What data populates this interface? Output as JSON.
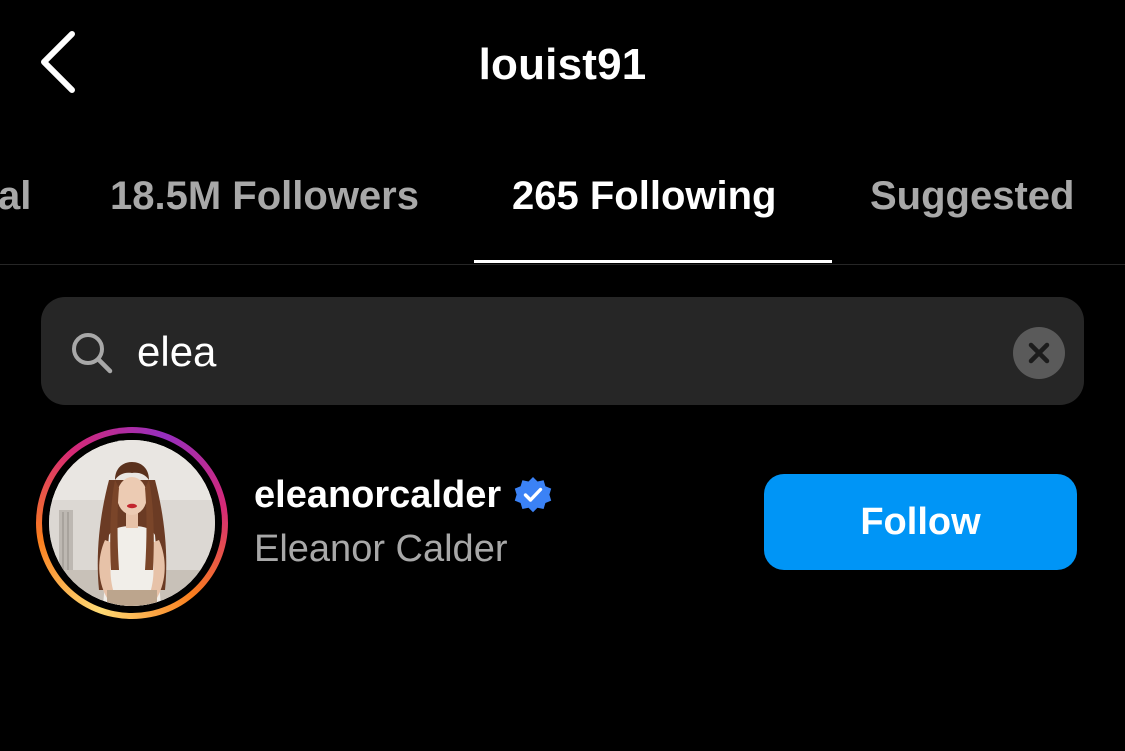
{
  "header": {
    "title": "louist91",
    "back_icon": "chevron-left-icon"
  },
  "tabs": [
    {
      "label": "al",
      "active": false
    },
    {
      "label": "18.5M Followers",
      "active": false
    },
    {
      "label": "265 Following",
      "active": true
    },
    {
      "label": "Suggested",
      "active": false
    }
  ],
  "search": {
    "value": "elea",
    "icon": "search-icon",
    "clear_icon": "close-icon"
  },
  "results": [
    {
      "username": "eleanorcalder",
      "full_name": "Eleanor Calder",
      "verified": true,
      "follow_label": "Follow"
    }
  ],
  "colors": {
    "background": "#000000",
    "primary_text": "#ffffff",
    "secondary_text": "#a8a8a8",
    "search_bg": "#262626",
    "follow_button": "#0095f6",
    "verified_badge": "#3b82f6"
  }
}
